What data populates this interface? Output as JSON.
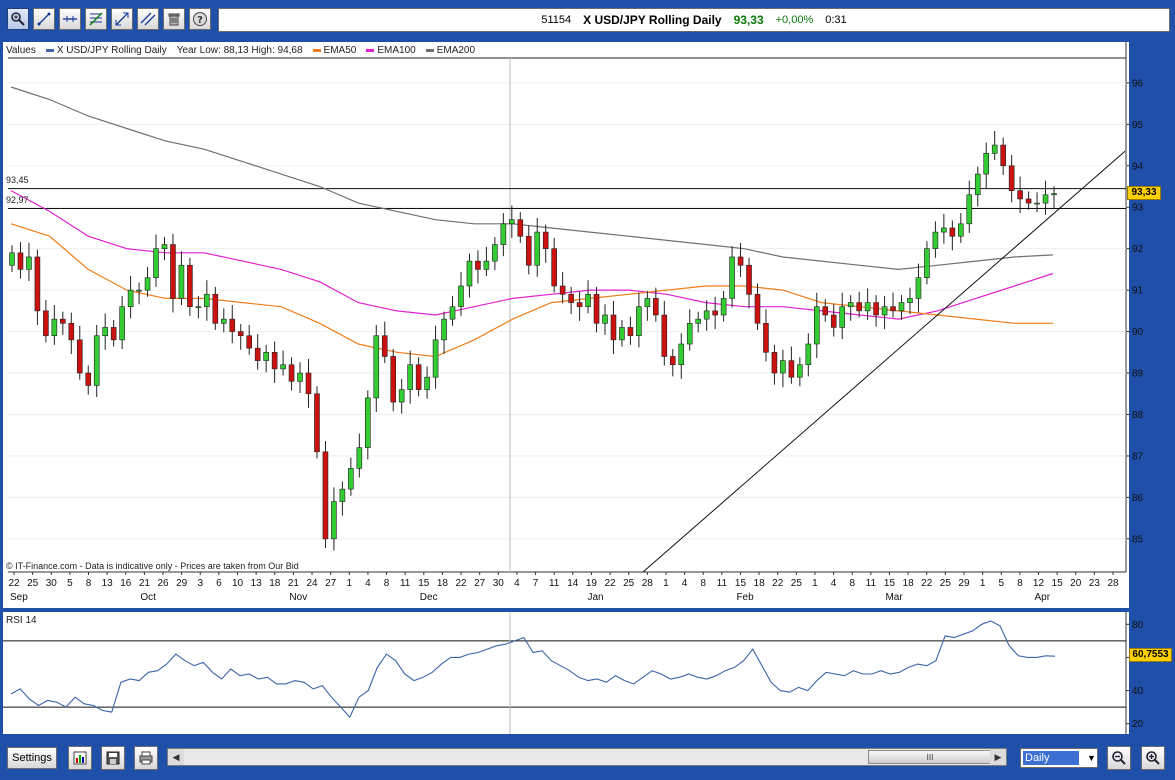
{
  "toolbar": {
    "icons": [
      "zoom-icon",
      "draw-line-icon",
      "horizontal-line-icon",
      "fibonacci-icon",
      "scale-icon",
      "parallel-lines-icon",
      "trash-icon",
      "help-icon"
    ]
  },
  "ticker": {
    "id": "51154",
    "name": "X USD/JPY Rolling Daily",
    "price": "93,33",
    "change": "+0,00%",
    "time": "0:31"
  },
  "legend": {
    "values_label": "Values",
    "series_label": "X USD/JPY Rolling Daily",
    "range_text": "Year Low: 88,13 High: 94,68",
    "ema50": "EMA50",
    "ema100": "EMA100",
    "ema200": "EMA200"
  },
  "colors": {
    "price_series": "#4a64a8",
    "ema50": "#f07d1a",
    "ema100": "#e020d0",
    "ema200": "#707070",
    "up_candle": "#33cc33",
    "down_candle": "#cc1111",
    "rsi": "#3b65a8",
    "last_tag": "#ffd000"
  },
  "levels": {
    "line1": "93,45",
    "line2": "92,97",
    "last_price_tag": "93,33",
    "rsi_value_tag": "60,7553"
  },
  "copyright": "© IT-Finance.com - Data is indicative only - Prices are taken from Our Bid",
  "rsi": {
    "title": "RSI 14",
    "ticks": [
      "80",
      "60",
      "40",
      "20"
    ]
  },
  "bottom": {
    "settings_label": "Settings",
    "period": "Daily",
    "scroll_grip": "III"
  },
  "chart_data": [
    {
      "type": "candlestick",
      "title": "X USD/JPY Rolling Daily",
      "ylim": [
        84.2,
        96.6
      ],
      "y_ticks": [
        85,
        86,
        87,
        88,
        89,
        90,
        91,
        92,
        93,
        94,
        95,
        96
      ],
      "x_ticks": [
        "22",
        "25",
        "30",
        "5",
        "8",
        "13",
        "16",
        "21",
        "26",
        "29",
        "3",
        "6",
        "10",
        "13",
        "18",
        "21",
        "24",
        "27",
        "1",
        "4",
        "8",
        "11",
        "15",
        "18",
        "22",
        "27",
        "30",
        "4",
        "7",
        "11",
        "14",
        "19",
        "22",
        "25",
        "28",
        "1",
        "4",
        "8",
        "11",
        "15",
        "18",
        "22",
        "25",
        "1",
        "4",
        "8",
        "11",
        "15",
        "18",
        "22",
        "25",
        "29",
        "1",
        "5",
        "8",
        "12",
        "15",
        "20",
        "23",
        "28"
      ],
      "months": [
        {
          "label": "Sep",
          "tick_index": 0
        },
        {
          "label": "Oct",
          "tick_index": 7
        },
        {
          "label": "Nov",
          "tick_index": 15
        },
        {
          "label": "Dec",
          "tick_index": 22
        },
        {
          "label": "Jan",
          "tick_index": 31
        },
        {
          "label": "Feb",
          "tick_index": 39
        },
        {
          "label": "Mar",
          "tick_index": 47
        },
        {
          "label": "Apr",
          "tick_index": 55
        }
      ],
      "horizontal_levels": [
        93.45,
        92.97
      ],
      "candles_close": [
        91.9,
        91.5,
        91.8,
        90.5,
        89.9,
        90.3,
        90.2,
        89.8,
        89.0,
        88.7,
        89.9,
        90.1,
        89.8,
        90.6,
        91.0,
        91.0,
        91.3,
        92.0,
        92.1,
        90.8,
        91.6,
        90.6,
        90.6,
        90.9,
        90.2,
        90.3,
        90.0,
        89.9,
        89.6,
        89.3,
        89.5,
        89.1,
        89.2,
        88.8,
        89.0,
        88.5,
        87.1,
        85.0,
        85.9,
        86.2,
        86.7,
        87.2,
        88.4,
        89.9,
        89.4,
        88.3,
        88.6,
        89.2,
        88.6,
        88.9,
        89.8,
        90.3,
        90.6,
        91.1,
        91.7,
        91.5,
        91.7,
        92.1,
        92.6,
        92.7,
        92.3,
        91.6,
        92.4,
        92.0,
        91.1,
        90.9,
        90.7,
        90.6,
        90.9,
        90.2,
        90.4,
        89.8,
        90.1,
        89.9,
        90.6,
        90.8,
        90.4,
        89.4,
        89.2,
        89.7,
        90.2,
        90.3,
        90.5,
        90.4,
        90.8,
        91.8,
        91.6,
        90.9,
        90.2,
        89.5,
        89.0,
        89.3,
        88.9,
        89.2,
        89.7,
        90.6,
        90.4,
        90.1,
        90.6,
        90.7,
        90.5,
        90.7,
        90.4,
        90.6,
        90.5,
        90.7,
        90.8,
        91.3,
        92.0,
        92.4,
        92.5,
        92.3,
        92.6,
        93.3,
        93.8,
        94.3,
        94.5,
        94.0,
        93.4,
        93.2,
        93.1,
        93.1,
        93.3,
        93.33
      ],
      "ema50": [
        92.6,
        92.3,
        91.5,
        91.0,
        90.8,
        90.8,
        90.7,
        90.6,
        90.2,
        89.7,
        89.5,
        89.4,
        89.8,
        90.3,
        90.7,
        90.8,
        90.9,
        91.0,
        91.1,
        91.1,
        91.0,
        90.7,
        90.6,
        90.5,
        90.4,
        90.3,
        90.2,
        90.2
      ],
      "ema100": [
        93.4,
        92.9,
        92.3,
        92.0,
        91.9,
        91.9,
        91.7,
        91.5,
        91.2,
        90.7,
        90.5,
        90.4,
        90.6,
        90.8,
        90.9,
        91.0,
        91.0,
        90.9,
        90.7,
        90.6,
        90.6,
        90.5,
        90.4,
        90.3,
        90.5,
        90.8,
        91.1,
        91.4
      ],
      "ema200": [
        95.9,
        95.6,
        95.2,
        94.9,
        94.6,
        94.4,
        94.1,
        93.8,
        93.5,
        93.1,
        92.9,
        92.7,
        92.6,
        92.6,
        92.5,
        92.4,
        92.3,
        92.2,
        92.1,
        92.0,
        91.8,
        91.7,
        91.6,
        91.5,
        91.6,
        91.7,
        91.8,
        91.85
      ]
    },
    {
      "type": "line",
      "title": "RSI 14",
      "ylim": [
        15,
        85
      ],
      "levels": [
        70,
        30
      ],
      "values": [
        38,
        41,
        35,
        31,
        34,
        33,
        30,
        36,
        32,
        31,
        28,
        27,
        45,
        47,
        46,
        51,
        52,
        56,
        62,
        58,
        55,
        57,
        51,
        47,
        53,
        49,
        50,
        47,
        48,
        44,
        44,
        46,
        45,
        41,
        43,
        36,
        30,
        24,
        36,
        40,
        54,
        62,
        58,
        50,
        46,
        48,
        51,
        56,
        60,
        60,
        62,
        63,
        65,
        67,
        68,
        70,
        72,
        63,
        64,
        58,
        55,
        52,
        48,
        46,
        47,
        45,
        49,
        46,
        44,
        48,
        52,
        50,
        47,
        48,
        50,
        48,
        47,
        49,
        52,
        54,
        58,
        65,
        55,
        45,
        40,
        39,
        42,
        40,
        46,
        51,
        50,
        49,
        52,
        50,
        50,
        52,
        50,
        51,
        54,
        56,
        55,
        58,
        73,
        72,
        74,
        76,
        80,
        82,
        79,
        67,
        61,
        60,
        60,
        61,
        60.76
      ]
    }
  ]
}
